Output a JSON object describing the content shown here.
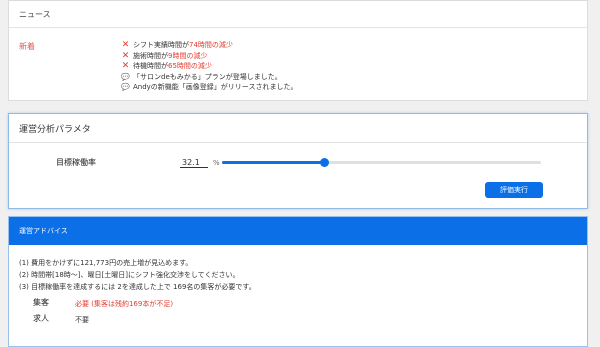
{
  "news": {
    "title": "ニュース",
    "tag": "新着",
    "items": [
      {
        "icon": "x-icon",
        "before": "シフト実績時間が",
        "highlight": "74時間の減少",
        "after": ""
      },
      {
        "icon": "x-icon",
        "before": "施術時間が",
        "highlight": "9時間の減少",
        "after": ""
      },
      {
        "icon": "x-icon",
        "before": "待機時間が",
        "highlight": "65時間の減少",
        "after": ""
      },
      {
        "icon": "chat-icon",
        "before": "「サロンdeもみかる」プランが登場しました。",
        "highlight": "",
        "after": ""
      },
      {
        "icon": "chat-icon",
        "before": "Andyの新機能「画像登録」がリリースされました。",
        "highlight": "",
        "after": ""
      }
    ]
  },
  "analysis": {
    "title": "運営分析パラメタ",
    "param_label": "目標稼働率",
    "param_value": "32.1",
    "unit": "%",
    "slider_fraction": 0.321,
    "button_label": "評価実行"
  },
  "advice": {
    "title": "運営アドバイス",
    "lines": [
      "(1) 費用をかけずに121,773円の売上増が見込めます。",
      "(2) 時間帯[18時〜]、曜日[土曜日]にシフト強化交渉をしてください。",
      "(3) 目標稼働率を達成するには 2を達成した上で 169名の集客が必要です。"
    ],
    "stats": [
      {
        "label": "集客",
        "value": "必要 (集客は残約169本が不足)",
        "color": "#e53a2c"
      },
      {
        "label": "求人",
        "value": "不要",
        "color": "#333333"
      }
    ]
  },
  "colors": {
    "accent": "#0b6fe8",
    "alert": "#e53a2c"
  }
}
